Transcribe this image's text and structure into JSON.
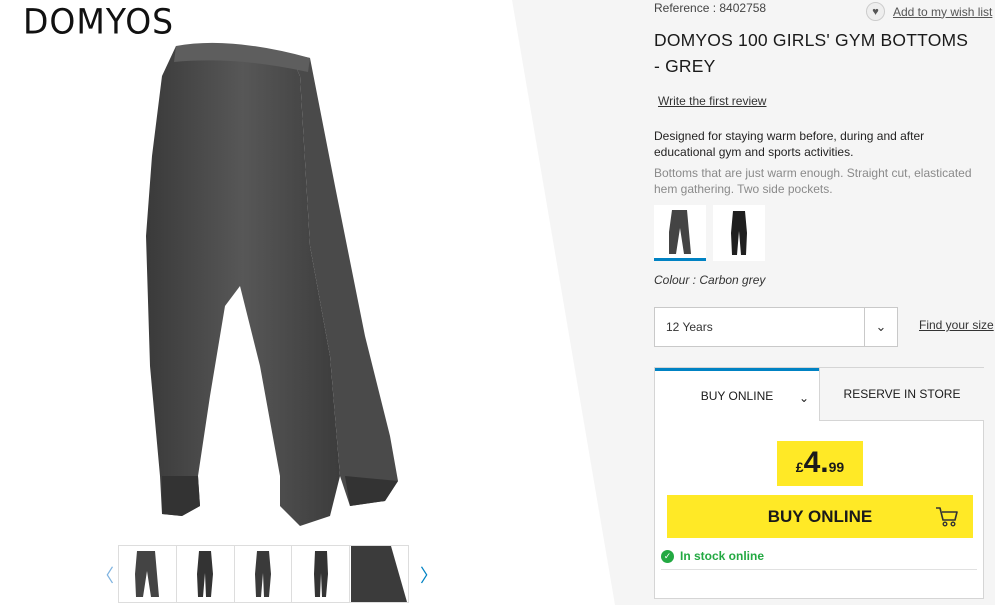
{
  "brand": "DOMYOS",
  "product": {
    "reference": "Reference : 8402758",
    "title": "DOMYOS 100 GIRLS' GYM BOTTOMS - GREY",
    "review_link": "Write the first review",
    "description_main": "Designed for staying warm before, during and after educational gym and sports activities.",
    "description_detail": "Bottoms that are just warm enough. Straight cut, elasticated hem gathering. Two side pockets.",
    "colour": "Colour : Carbon grey",
    "size_selected": "12 Years",
    "find_size": "Find your size"
  },
  "wishlist": {
    "label": "Add to my wish list"
  },
  "purchase": {
    "tab_online": "BUY ONLINE",
    "tab_store": "RESERVE IN STORE",
    "price_currency": "£",
    "price_int": "4.",
    "price_dec": "99",
    "buy_button": "BUY ONLINE",
    "stock": "In stock online"
  },
  "colors": {
    "accent": "#0082c3",
    "cta": "#ffe926",
    "stock": "#23a942"
  }
}
